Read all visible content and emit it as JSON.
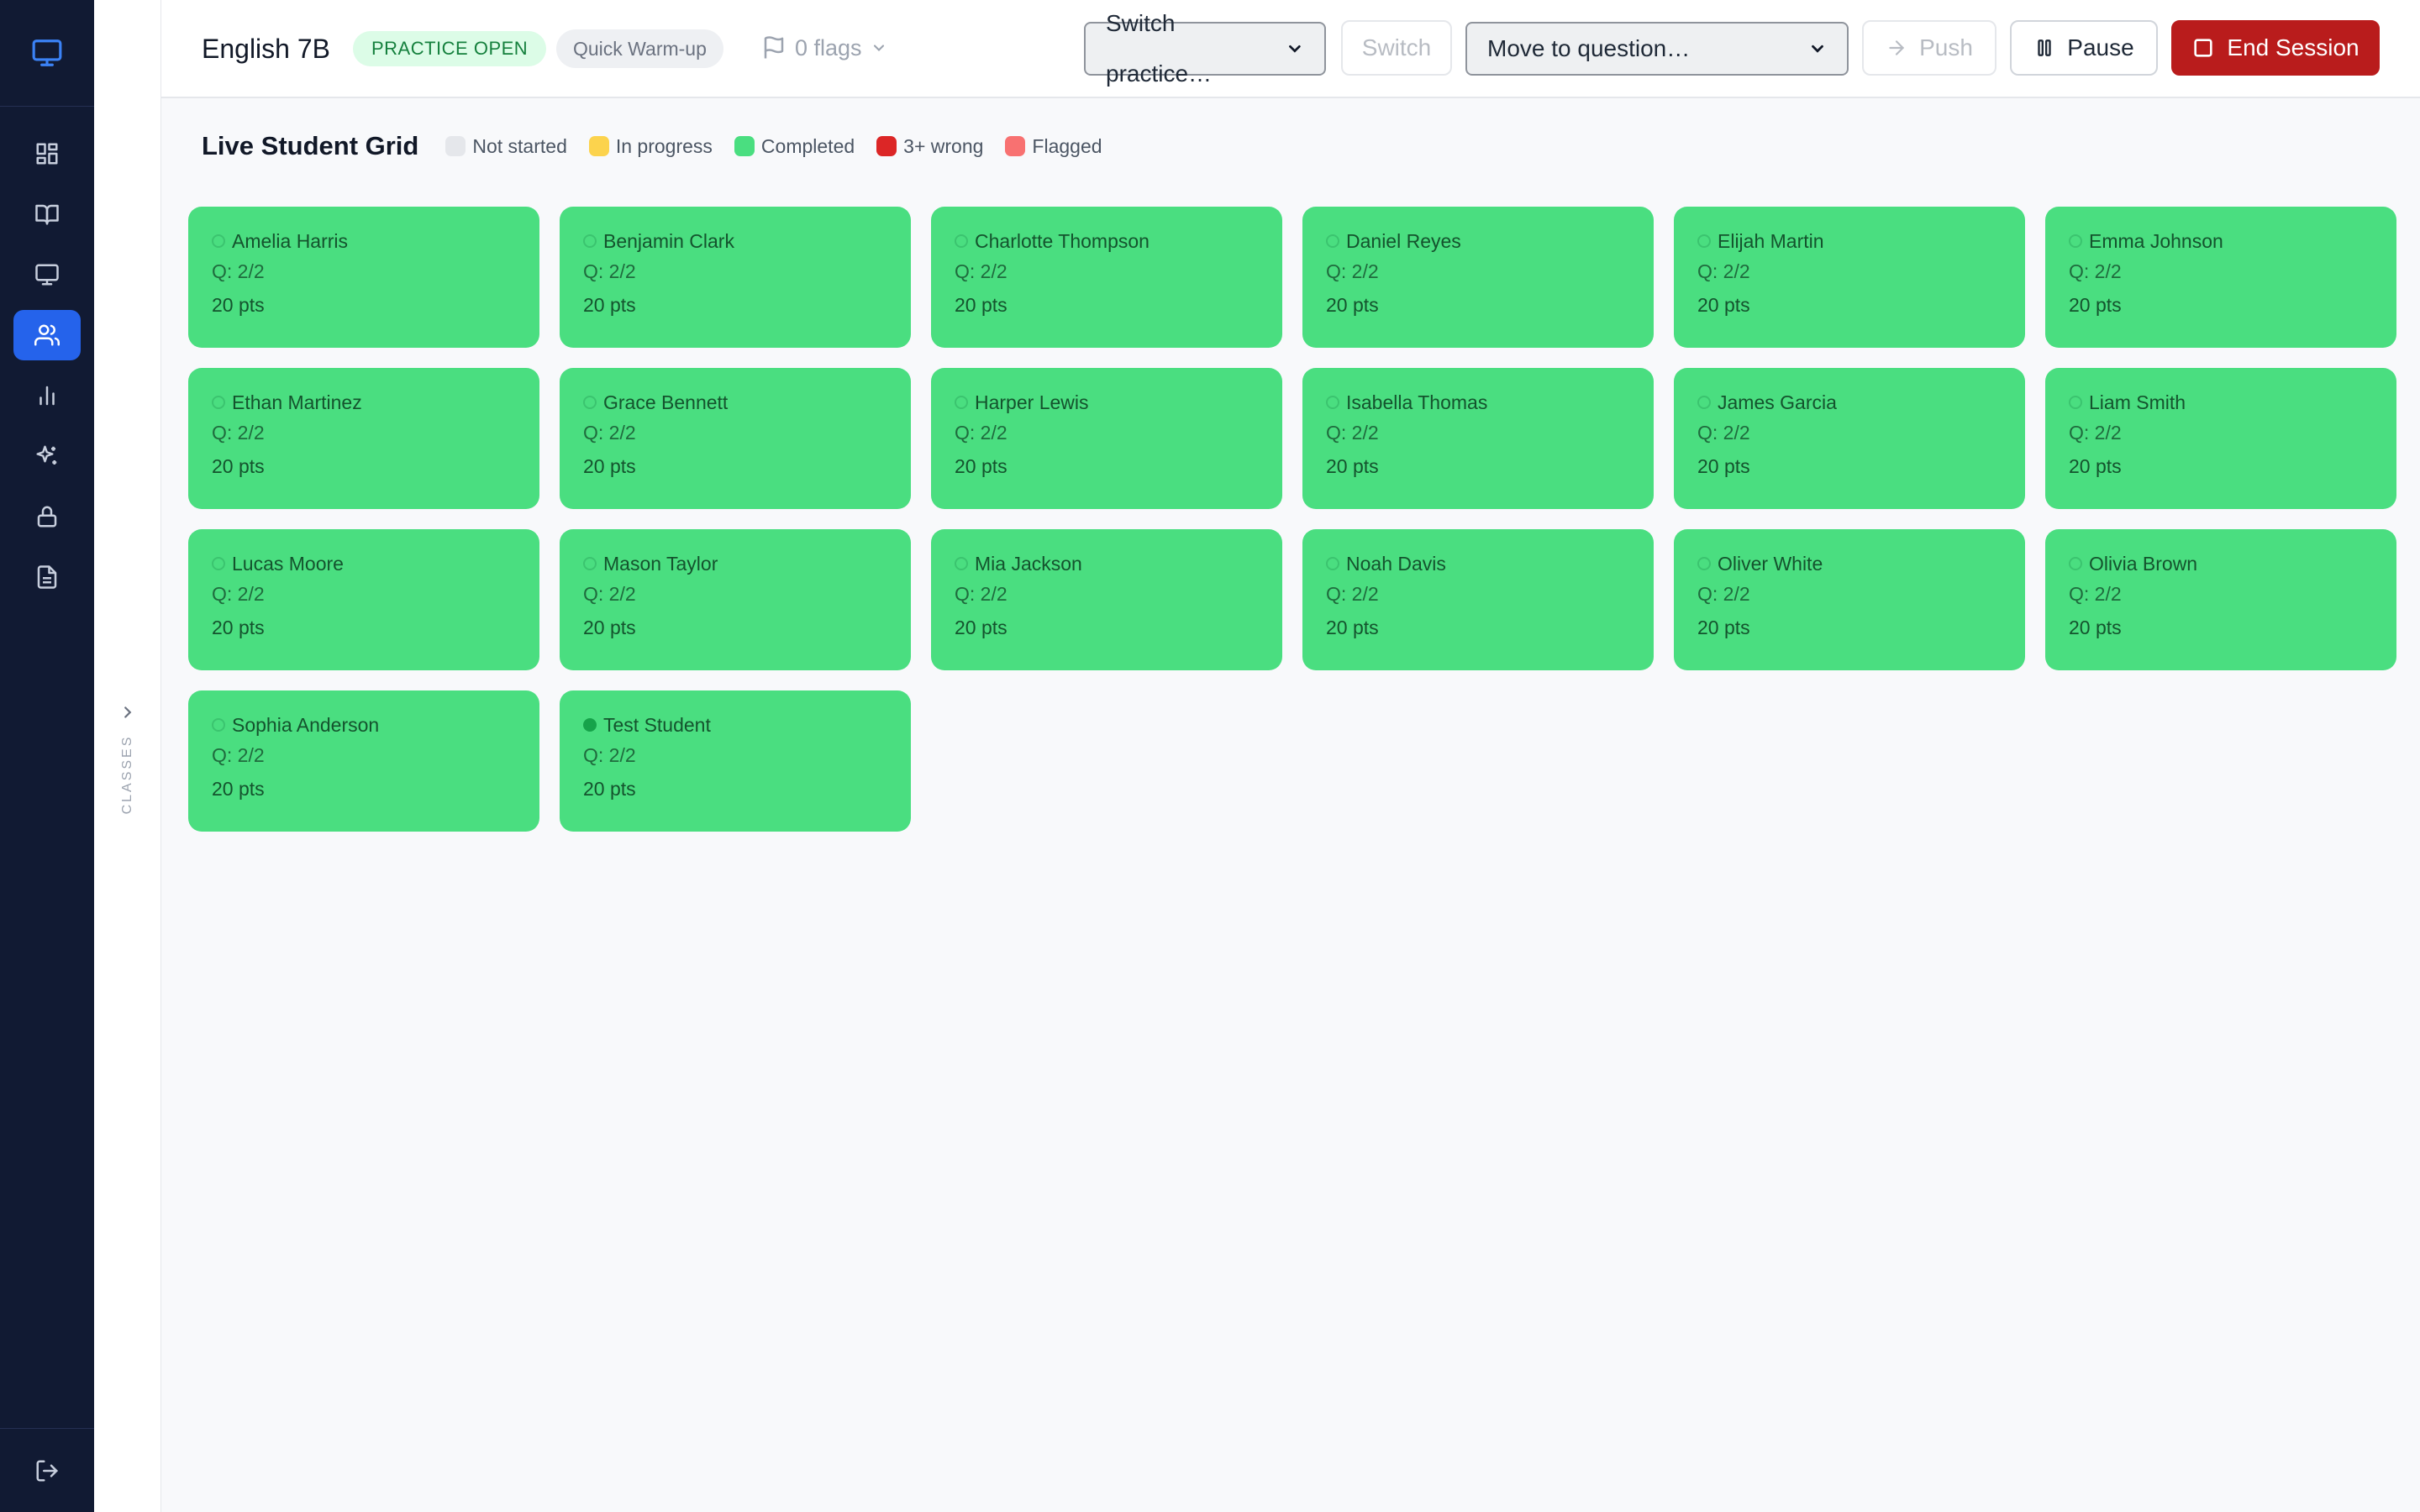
{
  "topbar": {
    "class_title": "English 7B",
    "status": "PRACTICE OPEN",
    "mode": "Quick Warm-up",
    "flags_label": "0 flags",
    "switch_select": "Switch practice…",
    "switch_button": "Switch",
    "move_select": "Move to question…",
    "push_button": "Push",
    "pause_button": "Pause",
    "end_button": "End Session"
  },
  "sidebar": {
    "icons": [
      "monitor-icon",
      "dashboard-icon",
      "book-icon",
      "monitor-icon",
      "users-icon",
      "bar-chart-icon",
      "sparkles-icon",
      "lock-icon",
      "document-icon"
    ],
    "active": "users-icon",
    "bottom_icon": "logout-icon"
  },
  "classes_panel": {
    "label": "CLASSES"
  },
  "grid": {
    "title": "Live Student Grid",
    "legend": [
      {
        "label": "Not started",
        "color": "#e5e7eb"
      },
      {
        "label": "In progress",
        "color": "#fcd34d"
      },
      {
        "label": "Completed",
        "color": "#4ade80"
      },
      {
        "label": "3+ wrong",
        "color": "#dc2626"
      },
      {
        "label": "Flagged",
        "color": "#f87171"
      }
    ],
    "students": [
      {
        "name": "Amelia Harris",
        "q": "Q: 2/2",
        "pts": "20 pts",
        "online": false
      },
      {
        "name": "Benjamin Clark",
        "q": "Q: 2/2",
        "pts": "20 pts",
        "online": false
      },
      {
        "name": "Charlotte Thompson",
        "q": "Q: 2/2",
        "pts": "20 pts",
        "online": false
      },
      {
        "name": "Daniel Reyes",
        "q": "Q: 2/2",
        "pts": "20 pts",
        "online": false
      },
      {
        "name": "Elijah Martin",
        "q": "Q: 2/2",
        "pts": "20 pts",
        "online": false
      },
      {
        "name": "Emma Johnson",
        "q": "Q: 2/2",
        "pts": "20 pts",
        "online": false
      },
      {
        "name": "Ethan Martinez",
        "q": "Q: 2/2",
        "pts": "20 pts",
        "online": false
      },
      {
        "name": "Grace Bennett",
        "q": "Q: 2/2",
        "pts": "20 pts",
        "online": false
      },
      {
        "name": "Harper Lewis",
        "q": "Q: 2/2",
        "pts": "20 pts",
        "online": false
      },
      {
        "name": "Isabella Thomas",
        "q": "Q: 2/2",
        "pts": "20 pts",
        "online": false
      },
      {
        "name": "James Garcia",
        "q": "Q: 2/2",
        "pts": "20 pts",
        "online": false
      },
      {
        "name": "Liam Smith",
        "q": "Q: 2/2",
        "pts": "20 pts",
        "online": false
      },
      {
        "name": "Lucas Moore",
        "q": "Q: 2/2",
        "pts": "20 pts",
        "online": false
      },
      {
        "name": "Mason Taylor",
        "q": "Q: 2/2",
        "pts": "20 pts",
        "online": false
      },
      {
        "name": "Mia Jackson",
        "q": "Q: 2/2",
        "pts": "20 pts",
        "online": false
      },
      {
        "name": "Noah Davis",
        "q": "Q: 2/2",
        "pts": "20 pts",
        "online": false
      },
      {
        "name": "Oliver White",
        "q": "Q: 2/2",
        "pts": "20 pts",
        "online": false
      },
      {
        "name": "Olivia Brown",
        "q": "Q: 2/2",
        "pts": "20 pts",
        "online": false
      },
      {
        "name": "Sophia Anderson",
        "q": "Q: 2/2",
        "pts": "20 pts",
        "online": false
      },
      {
        "name": "Test Student",
        "q": "Q: 2/2",
        "pts": "20 pts",
        "online": true
      }
    ]
  },
  "colors": {
    "rail_bg": "#111a33",
    "accent": "#2563eb",
    "completed": "#4ade80",
    "danger": "#b91c1c"
  }
}
